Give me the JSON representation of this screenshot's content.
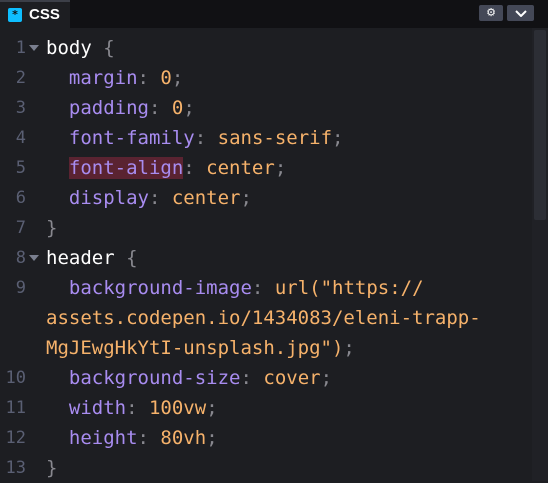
{
  "tab": {
    "label": "CSS",
    "icon": "*"
  },
  "header_buttons": {
    "settings_icon": "gear-icon",
    "collapse_icon": "chevron-down-icon"
  },
  "gutter": [
    "1",
    "2",
    "3",
    "4",
    "5",
    "6",
    "7",
    "8",
    "9",
    "",
    "",
    "10",
    "11",
    "12",
    "13"
  ],
  "colors": {
    "background": "#1d1e22",
    "selector": "#ffffff",
    "property": "#a88cf0",
    "value": "#f6b26b",
    "punctuation": "#88888f",
    "error_highlight": "#5a2331",
    "accent": "#0ebeff"
  },
  "code": {
    "l1": {
      "selector": "body",
      "brace": " {"
    },
    "l2": {
      "prop": "margin",
      "colon": ": ",
      "value": "0",
      "semi": ";"
    },
    "l3": {
      "prop": "padding",
      "colon": ": ",
      "value": "0",
      "semi": ";"
    },
    "l4": {
      "prop": "font-family",
      "colon": ": ",
      "value": "sans-serif",
      "semi": ";"
    },
    "l5": {
      "prop": "font-align",
      "colon": ": ",
      "value": "center",
      "semi": ";"
    },
    "l6": {
      "prop": "display",
      "colon": ": ",
      "value": "center",
      "semi": ";"
    },
    "l7": {
      "brace": "}"
    },
    "l8": {
      "selector": "header",
      "brace": " {"
    },
    "l9": {
      "prop": "background-image",
      "colon": ": ",
      "value": "url(\"https://"
    },
    "l9b": {
      "value": "assets.codepen.io/1434083/eleni-trapp-"
    },
    "l9c": {
      "value": "MgJEwgHkYtI-unsplash.jpg\")",
      "semi": ";"
    },
    "l10": {
      "prop": "background-size",
      "colon": ": ",
      "value": "cover",
      "semi": ";"
    },
    "l11": {
      "prop": "width",
      "colon": ": ",
      "value": "100vw",
      "semi": ";"
    },
    "l12": {
      "prop": "height",
      "colon": ": ",
      "value": "80vh",
      "semi": ";"
    },
    "l13": {
      "brace": "}"
    }
  }
}
